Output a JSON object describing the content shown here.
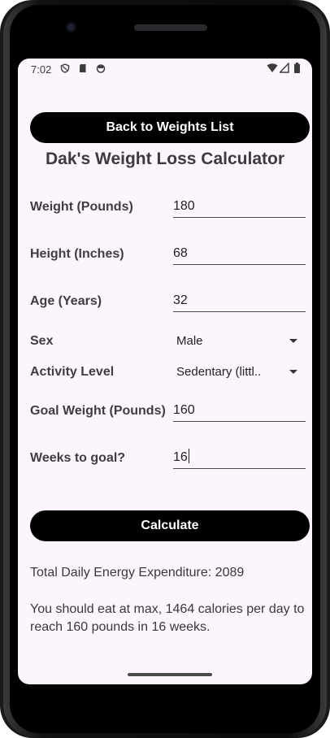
{
  "status_bar": {
    "time": "7:02",
    "left_icons": [
      "shield-icon",
      "sd-card-icon",
      "android-face-icon"
    ],
    "right_icons": [
      "wifi-icon",
      "signal-icon",
      "battery-icon"
    ]
  },
  "header": {
    "back_button_label": "Back to Weights List",
    "title": "Dak's Weight Loss Calculator"
  },
  "form": {
    "weight": {
      "label": "Weight (Pounds)",
      "value": "180"
    },
    "height": {
      "label": "Height (Inches)",
      "value": "68"
    },
    "age": {
      "label": "Age (Years)",
      "value": "32"
    },
    "sex": {
      "label": "Sex",
      "selected": "Male"
    },
    "activity": {
      "label": "Activity Level",
      "selected": "Sedentary (littl.."
    },
    "goal_weight": {
      "label": "Goal Weight (Pounds)",
      "value": "160"
    },
    "weeks": {
      "label": "Weeks to goal?",
      "value": "16"
    }
  },
  "actions": {
    "calculate_label": "Calculate"
  },
  "results": {
    "tdee": "Total Daily Energy Expenditure: 2089",
    "recommendation": "You should eat at max, 1464 calories per day to reach 160 pounds in 16 weeks."
  }
}
